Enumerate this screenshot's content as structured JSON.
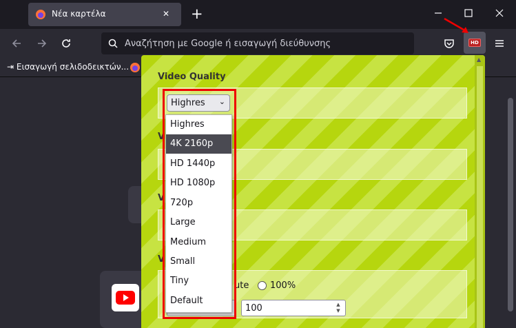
{
  "browser": {
    "tab_title": "Νέα καρτέλα",
    "url_placeholder": "Αναζήτηση με Google ή εισαγωγή διεύθυνσης",
    "bookmark_import_label": "Εισαγωγή σελιδοδεικτών...",
    "extension_badge": "HD"
  },
  "popup": {
    "video_quality_label": "Video Quality",
    "selected_quality": "Highres",
    "quality_options": [
      "Highres",
      "4K 2160p",
      "HD 1440p",
      "HD 1080p",
      "720p",
      "Large",
      "Medium",
      "Small",
      "Tiny",
      "Default"
    ],
    "highlighted_option": "4K 2160p",
    "partial_labels": [
      "V",
      "V",
      "V",
      "V"
    ],
    "volume_mute_label": "ute",
    "volume_100_label": "100%",
    "volume_value": "100"
  },
  "colors": {
    "accent_red": "#e00000",
    "popup_stripe_a": "#b6d60e",
    "popup_stripe_b": "#c7e342"
  },
  "icons": [
    "firefox-icon",
    "close-icon",
    "plus-icon",
    "minimize-icon",
    "maximize-icon",
    "back-icon",
    "forward-icon",
    "reload-icon",
    "search-icon",
    "pocket-icon",
    "menu-icon",
    "youtube-icon"
  ]
}
